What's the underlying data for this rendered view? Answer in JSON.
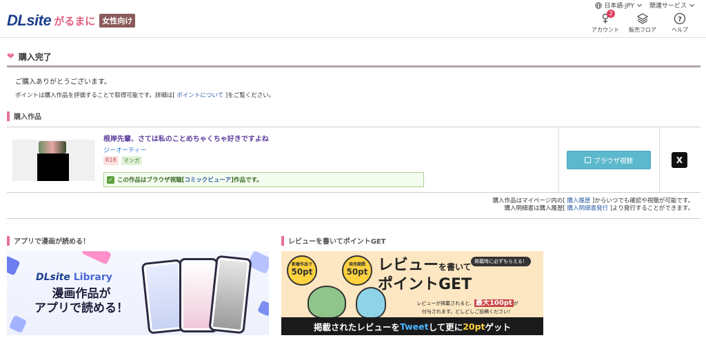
{
  "header": {
    "logo_main": "DLsite",
    "logo_sub": "がるまに",
    "logo_tag": "女性向け",
    "language": "日本語-JPY",
    "related": "関連サービス",
    "account_label": "アカウント",
    "account_badge": "2",
    "floor_label": "販売フロア",
    "help_label": "ヘルプ"
  },
  "page": {
    "title": "購入完了",
    "thanks": "ご購入ありがとうございます。",
    "point_pre": "ポイントは購入作品を評価することで取得可能です。詳細は[ ",
    "point_link": "ポイントについて",
    "point_post": " ]をご覧ください。"
  },
  "purchased": {
    "heading": "購入作品",
    "title": "根岸先輩、さては私のことめちゃくちゃ好きですよね",
    "maker": "ジーオーティー",
    "tags": [
      "R18",
      "マンガ"
    ],
    "viewer_pre": "この作品はブラウザ視聴[ ",
    "viewer_link": "コミックビューア",
    "viewer_post": " ]作品です。",
    "browse_button": "ブラウザ視聴",
    "share_icon": "X"
  },
  "notes": {
    "line1_pre": "購入作品はマイページ内の[ ",
    "line1_link": "購入履歴",
    "line1_post": " ]からいつでも確認や視聴が可能です。",
    "line2_pre": "購入明細書は購入履歴[ ",
    "line2_link": "購入明細書発行",
    "line2_post": " ]より発行することができます。"
  },
  "app_section": {
    "heading": "アプリで漫画が読める！",
    "logo_main": "DLsite",
    "logo_sub": "Library",
    "line1": "漫画作品が",
    "line2": "アプリで読める！"
  },
  "review_section": {
    "heading": "レビューを書いてポイントGET",
    "badge1_small": "新着作品で",
    "badge1_big": "50pt",
    "badge2_small": "発売期間",
    "badge2_big": "50pt",
    "note": "掲載時に必ずもらえる！",
    "title_a": "レビュー",
    "title_b": "を書いて",
    "title_c": "ポイントGET",
    "desc_pre": "レビューが掲載されると、",
    "desc_hl": "最大100pt",
    "desc_post": "が",
    "desc_line2": "付与されます。どしどしご投稿ください！",
    "bottom_a": "掲載されたレビューを",
    "bottom_b": "Tweet",
    "bottom_c": "して更に",
    "bottom_d": "20pt",
    "bottom_e": "ゲット"
  }
}
